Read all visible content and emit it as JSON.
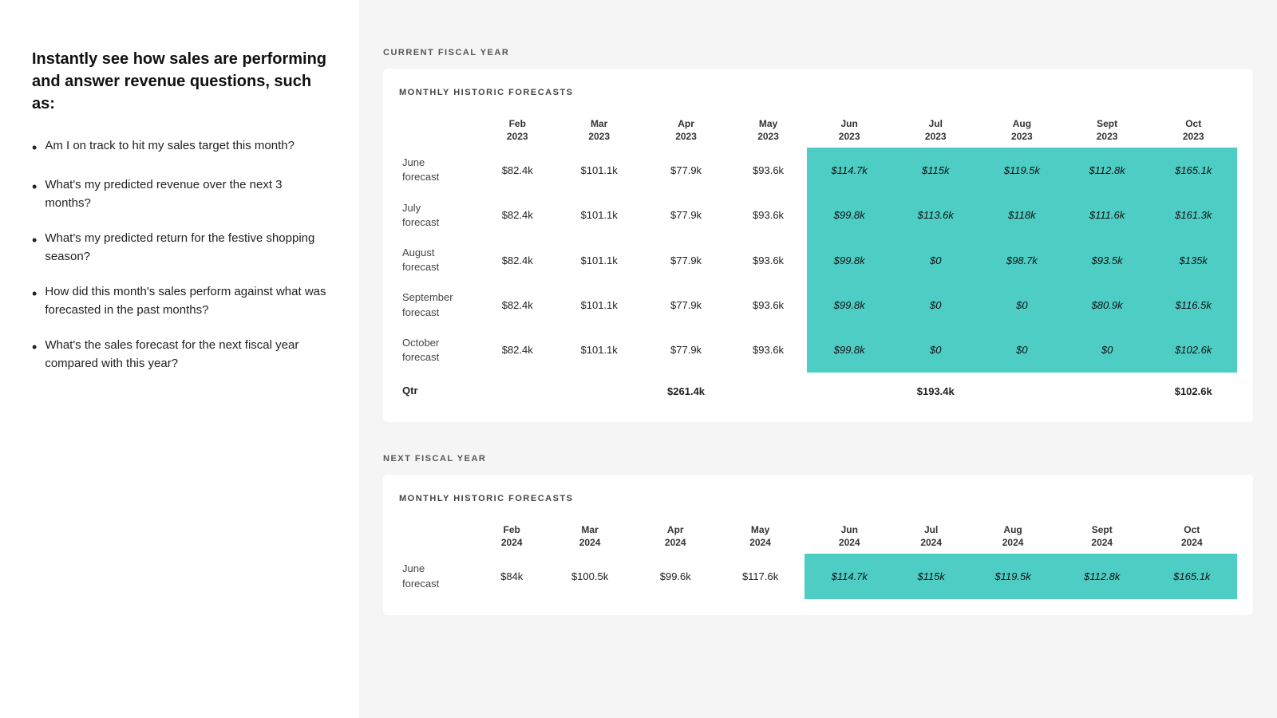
{
  "left": {
    "heading": "Instantly see how sales are performing and answer revenue questions, such as:",
    "bullets": [
      "Am I on track to hit my sales target this month?",
      "What's my predicted revenue over the next 3 months?",
      "What's my predicted return for the festive shopping season?",
      "How did this month's sales perform against what was forecasted in the past months?",
      "What's the sales forecast for the next fiscal year compared with this year?"
    ]
  },
  "sections": [
    {
      "label": "CURRENT FISCAL YEAR",
      "table_title": "MONTHLY HISTORIC FORECASTS",
      "columns": [
        {
          "line1": "Feb",
          "line2": "2023"
        },
        {
          "line1": "Mar",
          "line2": "2023"
        },
        {
          "line1": "Apr",
          "line2": "2023"
        },
        {
          "line1": "May",
          "line2": "2023"
        },
        {
          "line1": "Jun",
          "line2": "2023"
        },
        {
          "line1": "Jul",
          "line2": "2023"
        },
        {
          "line1": "Aug",
          "line2": "2023"
        },
        {
          "line1": "Sept",
          "line2": "2023"
        },
        {
          "line1": "Oct",
          "line2": "2023"
        }
      ],
      "rows": [
        {
          "label": "June forecast",
          "values": [
            "$82.4k",
            "$101.1k",
            "$77.9k",
            "$93.6k",
            "$114.7k",
            "$115k",
            "$119.5k",
            "$112.8k",
            "$165.1k"
          ],
          "style": [
            "white",
            "white",
            "white",
            "white",
            "teal",
            "teal",
            "teal",
            "teal",
            "teal"
          ]
        },
        {
          "label": "July forecast",
          "values": [
            "$82.4k",
            "$101.1k",
            "$77.9k",
            "$93.6k",
            "$99.8k",
            "$113.6k",
            "$118k",
            "$111.6k",
            "$161.3k"
          ],
          "style": [
            "white",
            "white",
            "white",
            "white",
            "teal",
            "teal",
            "teal",
            "teal",
            "teal"
          ]
        },
        {
          "label": "August forecast",
          "values": [
            "$82.4k",
            "$101.1k",
            "$77.9k",
            "$93.6k",
            "$99.8k",
            "$0",
            "$98.7k",
            "$93.5k",
            "$135k"
          ],
          "style": [
            "white",
            "white",
            "white",
            "white",
            "teal",
            "teal",
            "teal",
            "teal",
            "teal"
          ]
        },
        {
          "label": "September forecast",
          "values": [
            "$82.4k",
            "$101.1k",
            "$77.9k",
            "$93.6k",
            "$99.8k",
            "$0",
            "$0",
            "$80.9k",
            "$116.5k"
          ],
          "style": [
            "white",
            "white",
            "white",
            "white",
            "teal",
            "teal",
            "teal",
            "teal",
            "teal"
          ]
        },
        {
          "label": "October forecast",
          "values": [
            "$82.4k",
            "$101.1k",
            "$77.9k",
            "$93.6k",
            "$99.8k",
            "$0",
            "$0",
            "$0",
            "$102.6k"
          ],
          "style": [
            "white",
            "white",
            "white",
            "white",
            "teal",
            "teal",
            "teal",
            "teal",
            "teal"
          ]
        }
      ],
      "qtr_row": {
        "label": "Qtr",
        "values": [
          "",
          "",
          "$261.4k",
          "",
          "",
          "$193.4k",
          "",
          "",
          "$102.6k"
        ]
      }
    },
    {
      "label": "NEXT FISCAL YEAR",
      "table_title": "MONTHLY HISTORIC FORECASTS",
      "columns": [
        {
          "line1": "Feb",
          "line2": "2024"
        },
        {
          "line1": "Mar",
          "line2": "2024"
        },
        {
          "line1": "Apr",
          "line2": "2024"
        },
        {
          "line1": "May",
          "line2": "2024"
        },
        {
          "line1": "Jun",
          "line2": "2024"
        },
        {
          "line1": "Jul",
          "line2": "2024"
        },
        {
          "line1": "Aug",
          "line2": "2024"
        },
        {
          "line1": "Sept",
          "line2": "2024"
        },
        {
          "line1": "Oct",
          "line2": "2024"
        }
      ],
      "rows": [
        {
          "label": "June forecast",
          "values": [
            "$84k",
            "$100.5k",
            "$99.6k",
            "$117.6k",
            "$114.7k",
            "$115k",
            "$119.5k",
            "$112.8k",
            "$165.1k"
          ],
          "style": [
            "white",
            "white",
            "white",
            "white",
            "teal",
            "teal",
            "teal",
            "teal",
            "teal"
          ]
        }
      ],
      "qtr_row": null
    }
  ]
}
